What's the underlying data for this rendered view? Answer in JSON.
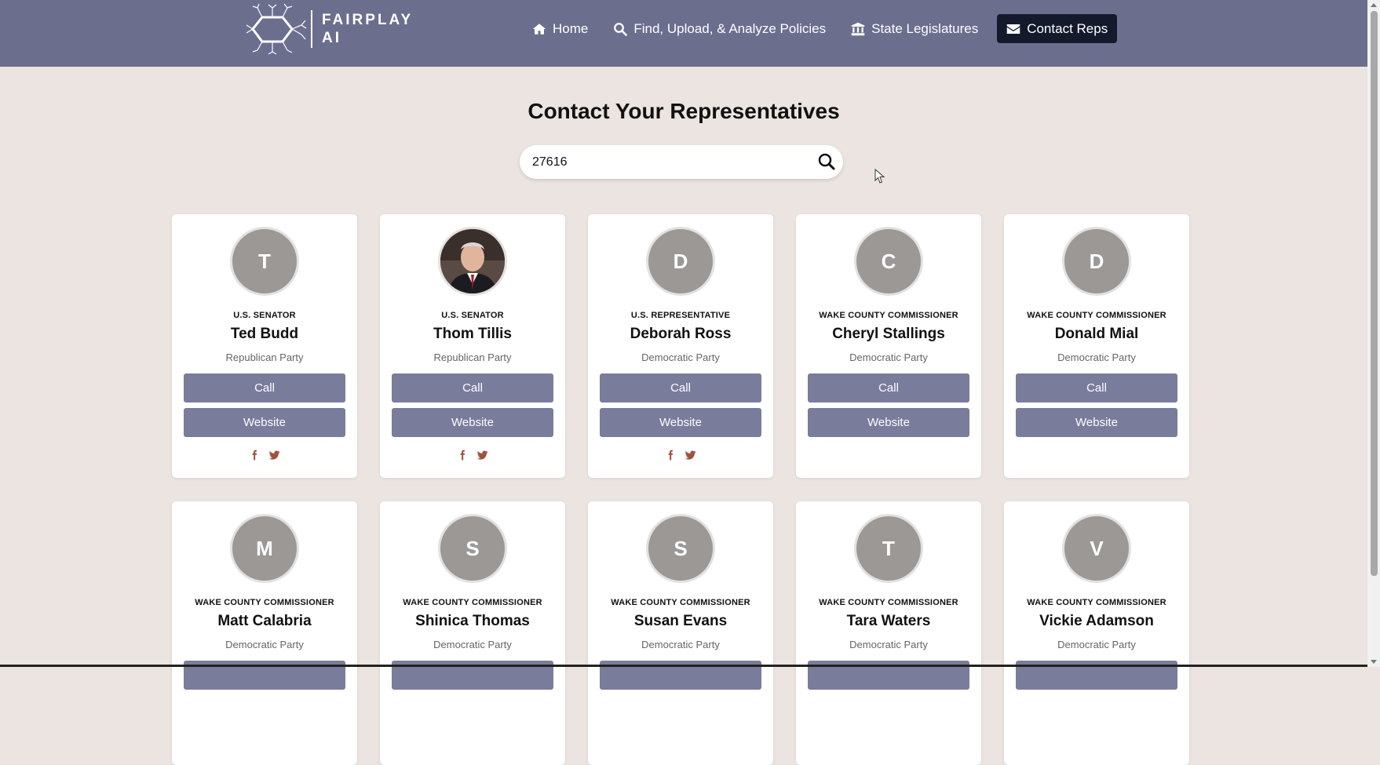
{
  "nav": {
    "logo_line1": "FAIRPLAY",
    "logo_line2": "AI",
    "links": [
      {
        "label": "Home",
        "icon": "home-icon"
      },
      {
        "label": "Find, Upload, & Analyze Policies",
        "icon": "search-icon"
      },
      {
        "label": "State Legislatures",
        "icon": "building-icon"
      },
      {
        "label": "Contact Reps",
        "icon": "envelope-icon"
      }
    ],
    "active_color": "#141a2c",
    "bar_color": "#6c6e8e"
  },
  "page": {
    "title": "Contact Your Representatives"
  },
  "search": {
    "value": "27616"
  },
  "reps": [
    {
      "initial": "T",
      "role": "U.S. Senator",
      "name": "Ted Budd",
      "party": "Republican Party",
      "call": "Call",
      "website": "Website"
    },
    {
      "initial": "",
      "role": "U.S. Senator",
      "name": "Thom Tillis",
      "party": "Republican Party",
      "call": "Call",
      "website": "Website"
    },
    {
      "initial": "D",
      "role": "U.S. Representative",
      "name": "Deborah Ross",
      "party": "Democratic Party",
      "call": "Call",
      "website": "Website"
    },
    {
      "initial": "C",
      "role": "Wake County Commissioner",
      "name": "Cheryl Stallings",
      "party": "Democratic Party",
      "call": "Call",
      "website": "Website"
    },
    {
      "initial": "D",
      "role": "Wake County Commissioner",
      "name": "Donald Mial",
      "party": "Democratic Party",
      "call": "Call",
      "website": "Website"
    },
    {
      "initial": "M",
      "role": "Wake County Commissioner",
      "name": "Matt Calabria",
      "party": "Democratic Party"
    },
    {
      "initial": "S",
      "role": "Wake County Commissioner",
      "name": "Shinica Thomas",
      "party": "Democratic Party"
    },
    {
      "initial": "S",
      "role": "Wake County Commissioner",
      "name": "Susan Evans",
      "party": "Democratic Party"
    },
    {
      "initial": "T",
      "role": "Wake County Commissioner",
      "name": "Tara Waters",
      "party": "Democratic Party"
    },
    {
      "initial": "V",
      "role": "Wake County Commissioner",
      "name": "Vickie Adamson",
      "party": "Democratic Party"
    }
  ],
  "colors": {
    "button": "#7a7c9c",
    "social": "#a0533a",
    "avatar": "#9c9895",
    "background": "#ebe4e0"
  }
}
